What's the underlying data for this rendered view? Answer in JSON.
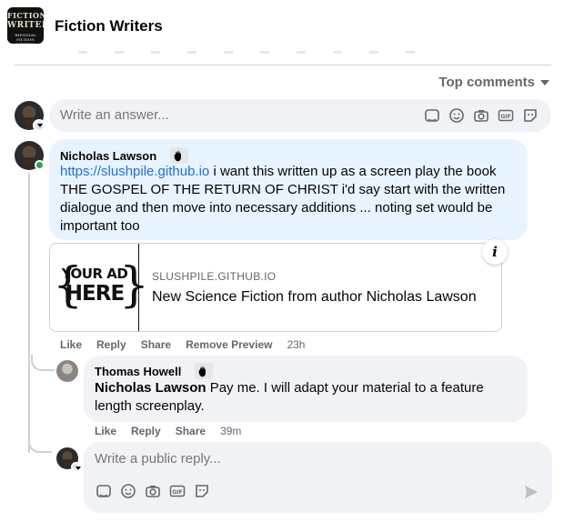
{
  "header": {
    "group_name": "Fiction Writers",
    "logo_line1": "FICTION",
    "logo_line2": "WRITERS",
    "logo_line3": "BIENNIAL FICTION WRITING CIRCLE"
  },
  "sort": {
    "label": "Top comments"
  },
  "composer": {
    "placeholder": "Write an answer..."
  },
  "comment": {
    "author": "Nicholas Lawson",
    "link_text": "https://slushpile.github.io",
    "text": " i want this written up as a screen play the book THE GOSPEL OF THE RETURN OF CHRIST i'd say start with the written dialogue and then move into necessary additions ... noting set would be important too",
    "actions": {
      "like": "Like",
      "reply": "Reply",
      "share": "Share",
      "remove_preview": "Remove Preview",
      "time": "23h"
    }
  },
  "link_preview": {
    "domain": "SLUSHPILE.GITHUB.IO",
    "title": "New Science Fiction from author Nicholas Lawson",
    "thumb_line1": "YOUR AD",
    "thumb_line2": "HERE",
    "info_glyph": "i"
  },
  "reply": {
    "author": "Thomas Howell",
    "mention": "Nicholas Lawson",
    "text": " Pay me. I will adapt your material to a feature length screenplay.",
    "actions": {
      "like": "Like",
      "reply": "Reply",
      "share": "Share",
      "time": "39m"
    }
  },
  "reply_composer": {
    "placeholder": "Write a public reply..."
  },
  "icons": [
    "sticker-icon",
    "emoji-icon",
    "camera-icon",
    "gif-icon",
    "avatar-sticker-icon",
    "send-icon",
    "wave-badge-icon"
  ],
  "colors": {
    "accent_link": "#216fdb",
    "bubble_blue": "#e7f3ff",
    "bubble_gray": "#f0f2f5",
    "online": "#31a24c"
  }
}
